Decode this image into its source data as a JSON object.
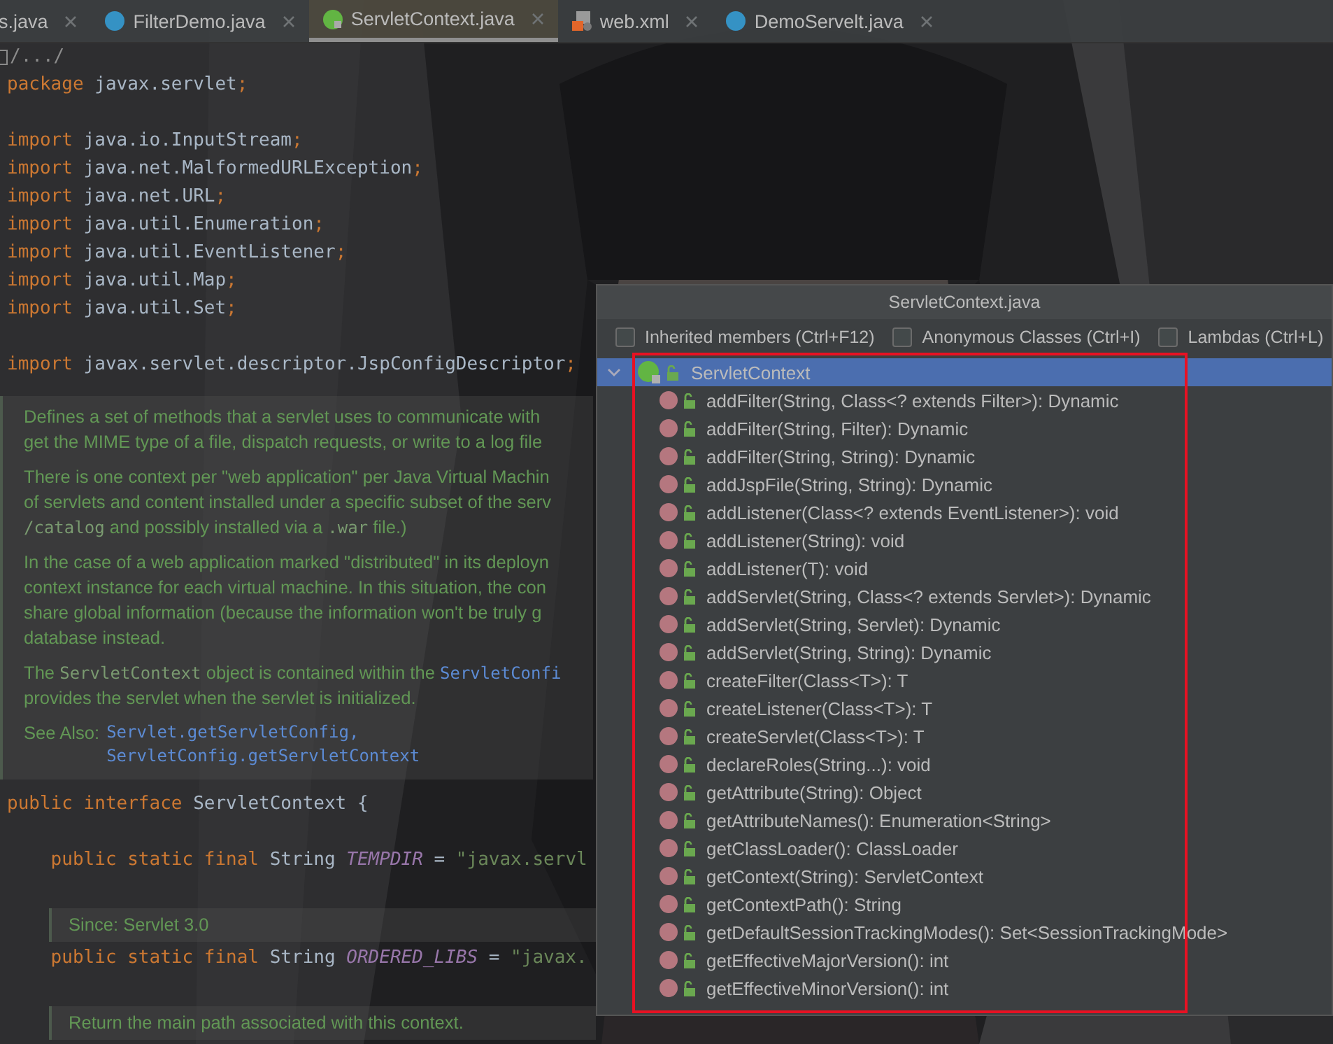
{
  "tabs": [
    {
      "kind": "none",
      "label": "s.java",
      "selected": false
    },
    {
      "kind": "class",
      "label": "FilterDemo.java",
      "selected": false
    },
    {
      "kind": "interface",
      "label": "ServletContext.java",
      "selected": true
    },
    {
      "kind": "xml",
      "label": "web.xml",
      "selected": false
    },
    {
      "kind": "class",
      "label": "DemoServelt.java",
      "selected": false
    }
  ],
  "editor": {
    "lines": [
      {
        "kind": "fold",
        "text": "/.../"
      },
      {
        "kind": "code",
        "tokens": [
          {
            "kind": "kw",
            "text": "package "
          },
          {
            "kind": "id",
            "text": "javax.servlet"
          },
          {
            "kind": "kw",
            "text": ";"
          }
        ]
      },
      {
        "kind": "blank"
      },
      {
        "kind": "code",
        "tokens": [
          {
            "kind": "kw",
            "text": "import "
          },
          {
            "kind": "id",
            "text": "java.io.InputStream"
          },
          {
            "kind": "kw",
            "text": ";"
          }
        ]
      },
      {
        "kind": "code",
        "tokens": [
          {
            "kind": "kw",
            "text": "import "
          },
          {
            "kind": "id",
            "text": "java.net.MalformedURLException"
          },
          {
            "kind": "kw",
            "text": ";"
          }
        ]
      },
      {
        "kind": "code",
        "tokens": [
          {
            "kind": "kw",
            "text": "import "
          },
          {
            "kind": "id",
            "text": "java.net.URL"
          },
          {
            "kind": "kw",
            "text": ";"
          }
        ]
      },
      {
        "kind": "code",
        "tokens": [
          {
            "kind": "kw",
            "text": "import "
          },
          {
            "kind": "id",
            "text": "java.util.Enumeration"
          },
          {
            "kind": "kw",
            "text": ";"
          }
        ]
      },
      {
        "kind": "code",
        "tokens": [
          {
            "kind": "kw",
            "text": "import "
          },
          {
            "kind": "id",
            "text": "java.util.EventListener"
          },
          {
            "kind": "kw",
            "text": ";"
          }
        ]
      },
      {
        "kind": "code",
        "tokens": [
          {
            "kind": "kw",
            "text": "import "
          },
          {
            "kind": "id",
            "text": "java.util.Map"
          },
          {
            "kind": "kw",
            "text": ";"
          }
        ]
      },
      {
        "kind": "code",
        "tokens": [
          {
            "kind": "kw",
            "text": "import "
          },
          {
            "kind": "id",
            "text": "java.util.Set"
          },
          {
            "kind": "kw",
            "text": ";"
          }
        ]
      },
      {
        "kind": "blank"
      },
      {
        "kind": "code",
        "tokens": [
          {
            "kind": "kw",
            "text": "import "
          },
          {
            "kind": "id",
            "text": "javax.servlet.descriptor.JspConfigDescriptor"
          },
          {
            "kind": "kw",
            "text": ";"
          }
        ]
      },
      {
        "kind": "doc",
        "paragraphs": [
          [
            [
              {
                "kind": "text",
                "text": "Defines a set of methods that a servlet uses to communicate with"
              }
            ],
            [
              {
                "kind": "text",
                "text": "get the MIME type of a file, dispatch requests, or write to a log file"
              }
            ]
          ],
          [
            [
              {
                "kind": "text",
                "text": "There is one context per \"web application\" per Java Virtual Machin"
              }
            ],
            [
              {
                "kind": "text",
                "text": "of servlets and content installed under a specific subset of the serv"
              }
            ],
            [
              {
                "kind": "code",
                "text": "/catalog"
              },
              {
                "kind": "text",
                "text": " and possibly installed via a "
              },
              {
                "kind": "code",
                "text": ".war"
              },
              {
                "kind": "text",
                "text": " file.)"
              }
            ]
          ],
          [
            [
              {
                "kind": "text",
                "text": "In the case of a web application marked \"distributed\" in its deployn"
              }
            ],
            [
              {
                "kind": "text",
                "text": "context instance for each virtual machine. In this situation, the con"
              }
            ],
            [
              {
                "kind": "text",
                "text": "share global information (because the information won't be truly g"
              }
            ],
            [
              {
                "kind": "text",
                "text": "database instead."
              }
            ]
          ],
          [
            [
              {
                "kind": "text",
                "text": "The "
              },
              {
                "kind": "code",
                "text": "ServletContext"
              },
              {
                "kind": "text",
                "text": " object is contained within the "
              },
              {
                "kind": "link",
                "text": "ServletConfi"
              }
            ],
            [
              {
                "kind": "text",
                "text": "provides the servlet when the servlet is initialized."
              }
            ]
          ]
        ],
        "see_also": {
          "label": "See Also:",
          "links": [
            "Servlet.getServletConfig,",
            "ServletConfig.getServletContext"
          ]
        }
      },
      {
        "kind": "code",
        "tokens": [
          {
            "kind": "kw",
            "text": "public interface "
          },
          {
            "kind": "id",
            "text": "ServletContext {"
          }
        ]
      },
      {
        "kind": "blank"
      },
      {
        "kind": "code",
        "tokens": [
          {
            "kind": "kw",
            "text": "    public static final "
          },
          {
            "kind": "id",
            "text": "String "
          },
          {
            "kind": "const",
            "text": "TEMPDIR"
          },
          {
            "kind": "id",
            "text": " = "
          },
          {
            "kind": "str",
            "text": "\"javax.servl"
          }
        ]
      },
      {
        "kind": "blank"
      },
      {
        "kind": "member_doc",
        "paragraphs": [
          [
            [
              {
                "kind": "text",
                "text": "Since: Servlet 3.0"
              }
            ]
          ]
        ]
      },
      {
        "kind": "code",
        "tokens": [
          {
            "kind": "kw",
            "text": "    public static final "
          },
          {
            "kind": "id",
            "text": "String "
          },
          {
            "kind": "const",
            "text": "ORDERED_LIBS"
          },
          {
            "kind": "id",
            "text": " = "
          },
          {
            "kind": "str",
            "text": "\"javax."
          }
        ]
      },
      {
        "kind": "blank"
      },
      {
        "kind": "member_doc",
        "paragraphs": [
          [
            [
              {
                "kind": "text",
                "text": "Return the main path associated with this context."
              }
            ]
          ]
        ]
      }
    ]
  },
  "popup": {
    "title": "ServletContext.java",
    "filters": [
      {
        "label": "Inherited members (Ctrl+F12)",
        "checked": false
      },
      {
        "label": "Anonymous Classes (Ctrl+I)",
        "checked": false
      },
      {
        "label": "Lambdas (Ctrl+L)",
        "checked": false
      }
    ],
    "tree": [
      {
        "label": "ServletContext",
        "expanded": true,
        "selected": true,
        "children": [
          {
            "label": "addFilter(String, Class<? extends Filter>): Dynamic",
            "selected": false
          },
          {
            "label": "addFilter(String, Filter): Dynamic",
            "selected": false
          },
          {
            "label": "addFilter(String, String): Dynamic",
            "selected": false
          },
          {
            "label": "addJspFile(String, String): Dynamic",
            "selected": false
          },
          {
            "label": "addListener(Class<? extends EventListener>): void",
            "selected": false
          },
          {
            "label": "addListener(String): void",
            "selected": false
          },
          {
            "label": "addListener(T): void",
            "selected": false
          },
          {
            "label": "addServlet(String, Class<? extends Servlet>): Dynamic",
            "selected": false
          },
          {
            "label": "addServlet(String, Servlet): Dynamic",
            "selected": false
          },
          {
            "label": "addServlet(String, String): Dynamic",
            "selected": false
          },
          {
            "label": "createFilter(Class<T>): T",
            "selected": false
          },
          {
            "label": "createListener(Class<T>): T",
            "selected": false
          },
          {
            "label": "createServlet(Class<T>): T",
            "selected": false
          },
          {
            "label": "declareRoles(String...): void",
            "selected": false
          },
          {
            "label": "getAttribute(String): Object",
            "selected": false
          },
          {
            "label": "getAttributeNames(): Enumeration<String>",
            "selected": false
          },
          {
            "label": "getClassLoader(): ClassLoader",
            "selected": false
          },
          {
            "label": "getContext(String): ServletContext",
            "selected": false
          },
          {
            "label": "getContextPath(): String",
            "selected": false
          },
          {
            "label": "getDefaultSessionTrackingModes(): Set<SessionTrackingMode>",
            "selected": false
          },
          {
            "label": "getEffectiveMajorVersion(): int",
            "selected": false
          },
          {
            "label": "getEffectiveMinorVersion(): int",
            "selected": false
          }
        ]
      }
    ]
  }
}
